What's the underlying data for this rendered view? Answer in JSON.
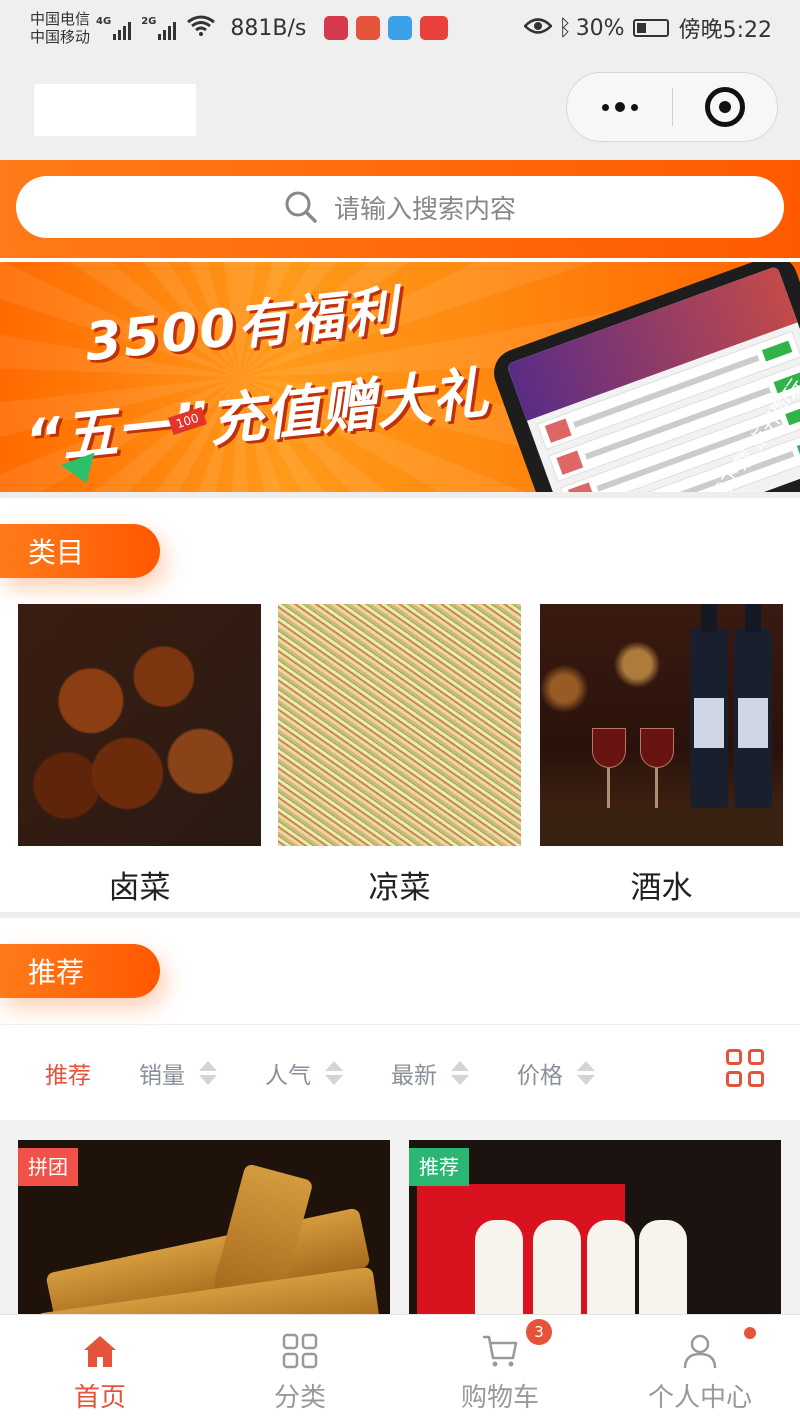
{
  "status_bar": {
    "carrier_1": "中国电信",
    "carrier_2": "中国移动",
    "net_1": "4G",
    "net_2": "2G",
    "speed": "881B/s",
    "battery": "30%",
    "time": "傍晚5:22"
  },
  "search": {
    "placeholder": "请输入搜索内容"
  },
  "banner": {
    "line1": "3500有福利",
    "line2": "“五一”充值赠大礼",
    "tag": "100",
    "slogan": "无需下载 点开即玩"
  },
  "sections": {
    "categories_title": "类目",
    "recommend_title": "推荐"
  },
  "categories": [
    {
      "label": "卤菜"
    },
    {
      "label": "凉菜"
    },
    {
      "label": "酒水"
    }
  ],
  "filters": [
    {
      "label": "推荐",
      "active": true
    },
    {
      "label": "销量"
    },
    {
      "label": "人气"
    },
    {
      "label": "最新"
    },
    {
      "label": "价格"
    }
  ],
  "products": [
    {
      "badge": "拼团",
      "badge_color": "#f0524a"
    },
    {
      "badge": "推荐",
      "badge_color": "#2bb673"
    }
  ],
  "tabbar": {
    "items": [
      {
        "label": "首页",
        "icon": "home-icon",
        "active": true
      },
      {
        "label": "分类",
        "icon": "category-grid-icon"
      },
      {
        "label": "购物车",
        "icon": "cart-icon"
      },
      {
        "label": "个人中心",
        "icon": "user-icon"
      }
    ],
    "cart_count": "3"
  },
  "colors": {
    "accent": "#e5533b",
    "orange": "#ff6a00"
  }
}
